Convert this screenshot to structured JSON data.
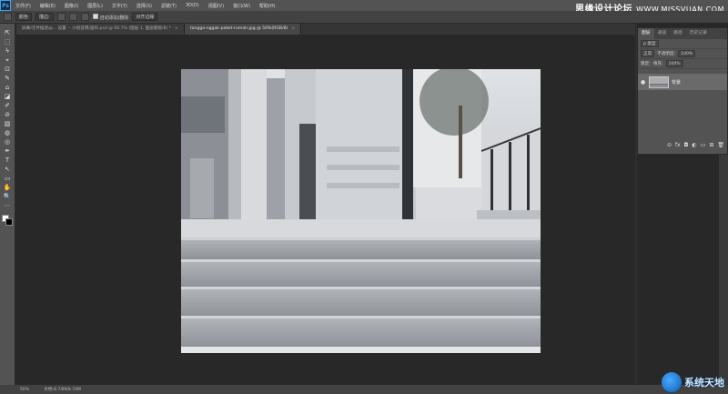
{
  "menubar": {
    "logo": "Ps",
    "items": [
      "文件(F)",
      "编辑(E)",
      "图像(I)",
      "图层(L)",
      "文字(Y)",
      "选择(S)",
      "滤镜(T)",
      "3D(D)",
      "视图(V)",
      "窗口(W)",
      "帮助(H)"
    ]
  },
  "watermark_top": {
    "main": "思缘设计论坛",
    "sub": "WWW.MISSVUAN.COM"
  },
  "options": {
    "mode_label": "颜色",
    "blend_label": "描边:",
    "auto_label": "自动添加/删除",
    "align_label": "对齐边缘"
  },
  "tabs": [
    {
      "label": "屏幕/元件描述@... 设置 -- 小组说明/画布.psd @ 66.7% (图层 1, 图层蒙版/8) *",
      "active": false
    },
    {
      "label": "tangga-nggak-paket-rumah.jpg @ 50%(RGB/8)",
      "active": true
    }
  ],
  "close_glyph": "×",
  "tools": [
    "⇱",
    "⬚",
    "ϟ",
    "⌖",
    "⊡",
    "✎",
    "⌂",
    "◪",
    "✐",
    "⊘",
    "▧",
    "◍",
    "◎",
    "✒",
    "T",
    "↖",
    "▭",
    "✋",
    "🔍",
    "⋯"
  ],
  "statusbar": {
    "zoom": "50%",
    "doc": "文档:8.74M/8.74M"
  },
  "panel": {
    "tabs": [
      "图层",
      "通道",
      "路径",
      "历史记录"
    ],
    "filter_label": "ρ 类型",
    "blend_mode": "正常",
    "opacity_label": "不透明度:",
    "opacity_value": "100%",
    "lock_label": "锁定:",
    "fill_label": "填充:",
    "fill_value": "100%",
    "layer_name": "背景",
    "footer_icons": [
      "⊝",
      "fx",
      "◘",
      "◐",
      "▭",
      "⊞",
      "🗑"
    ]
  },
  "watermark_bottom": {
    "text": "系统天地"
  }
}
